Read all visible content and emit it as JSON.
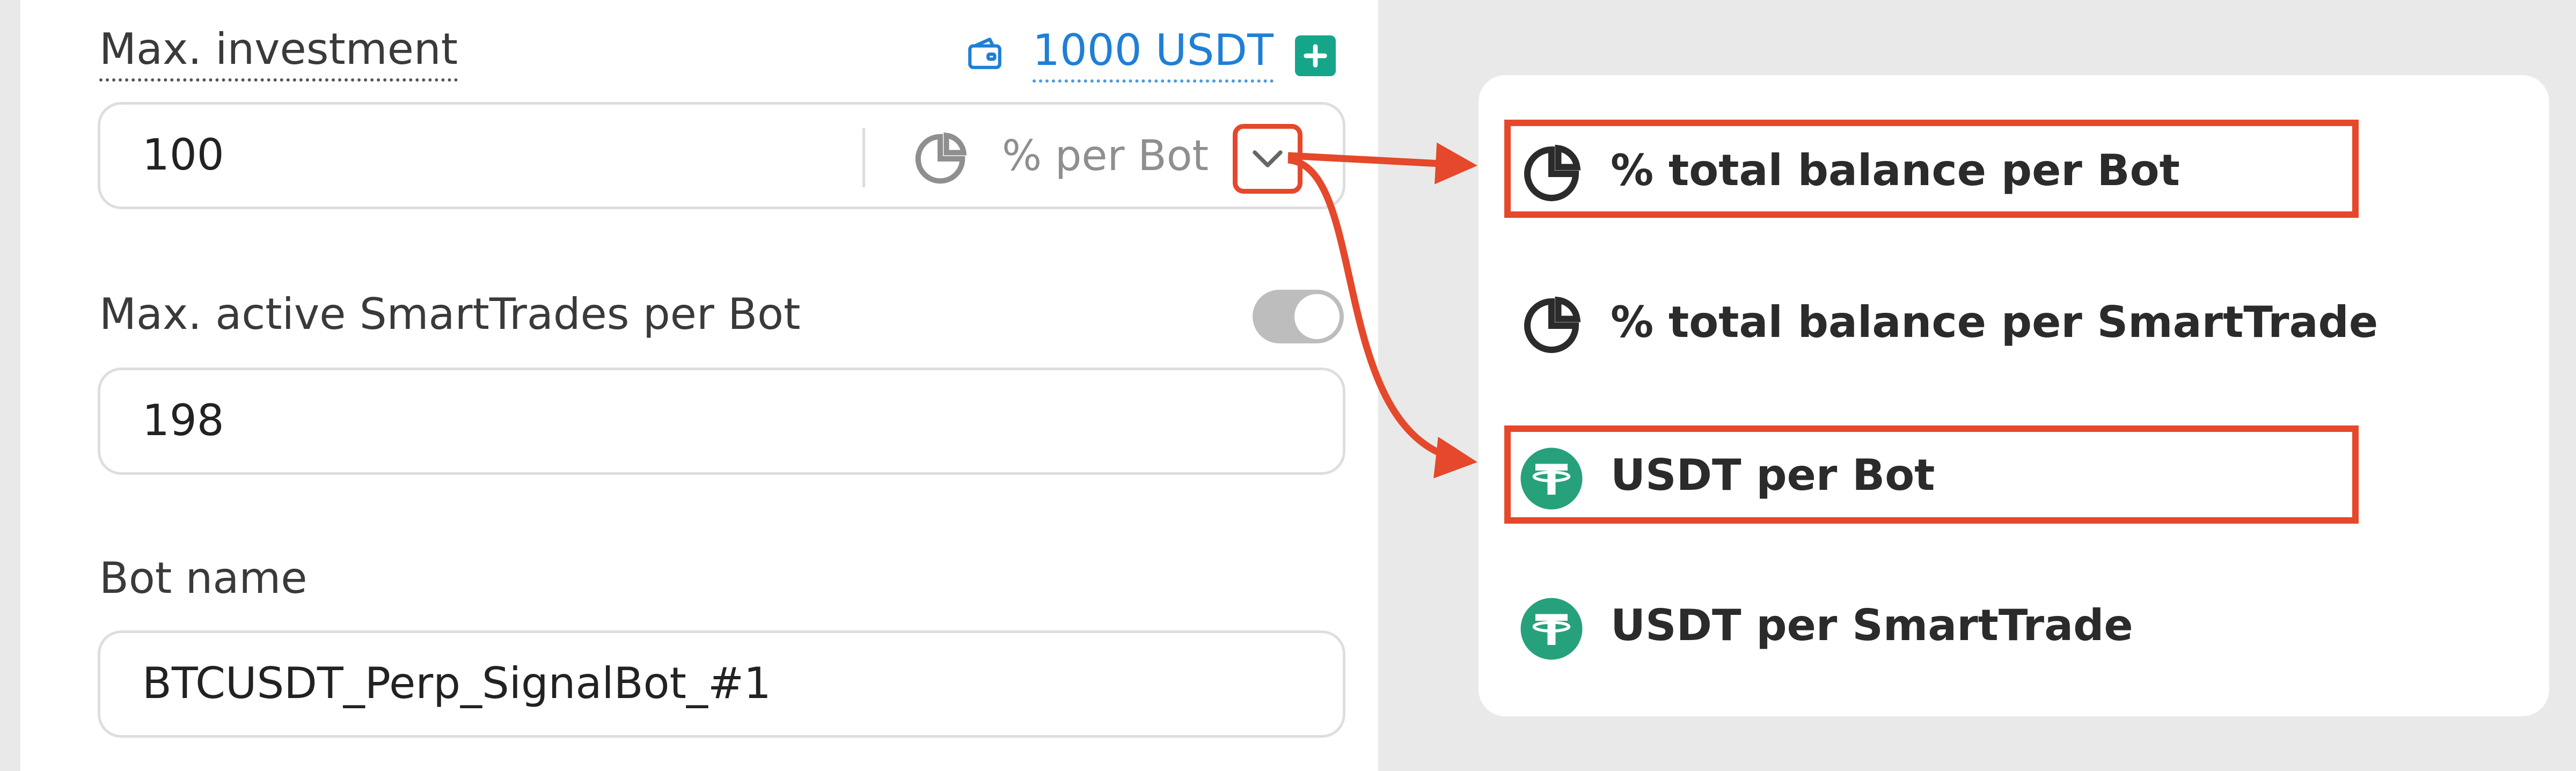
{
  "investment": {
    "label": "Max. investment",
    "balance": "1000 USDT",
    "value": "100",
    "mode_label": "% per Bot"
  },
  "smarttrades": {
    "label": "Max. active SmartTrades per Bot",
    "value": "198",
    "toggle_on": true
  },
  "bot_name": {
    "label": "Bot name",
    "value": "BTCUSDT_Perp_SignalBot_#1"
  },
  "dropdown": {
    "items": [
      {
        "label": "% total balance per Bot",
        "icon": "pie-chart-icon",
        "highlighted": true
      },
      {
        "label": "% total balance per SmartTrade",
        "icon": "pie-chart-icon",
        "highlighted": false
      },
      {
        "label": "USDT per Bot",
        "icon": "tether-icon",
        "highlighted": true
      },
      {
        "label": "USDT per SmartTrade",
        "icon": "tether-icon",
        "highlighted": false
      }
    ]
  },
  "colors": {
    "annotation": "#e5482b",
    "accent_blue": "#1f7fd6",
    "tether_green": "#26a17b",
    "add_button": "#15a68a"
  }
}
